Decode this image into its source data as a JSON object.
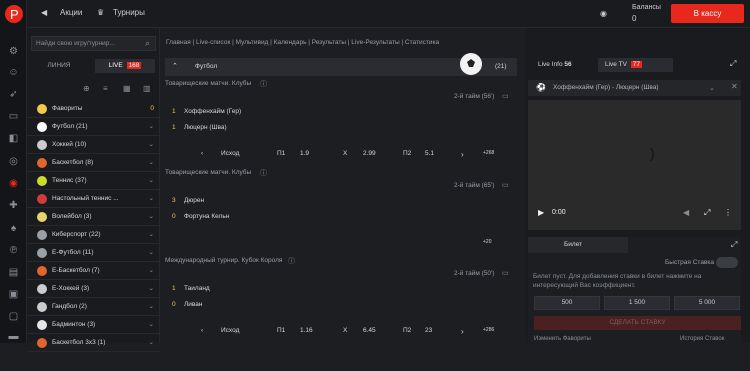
{
  "topbar": {
    "promo": "Акции",
    "tournaments": "Турниры",
    "balance_label": "Балансы",
    "balance_value": "0",
    "cashier": "В кассу"
  },
  "sidebar": {
    "search_placeholder": "Найди свою игру/турнир...",
    "tab_line": "ЛИНИЯ",
    "tab_live": "LIVE",
    "live_count": "168",
    "items": [
      {
        "label": "Фавориты",
        "count": "0",
        "color": "#f2c94c"
      },
      {
        "label": "Футбол (21)",
        "color": "#ffffff"
      },
      {
        "label": "Хоккей (10)",
        "color": "#cccccc"
      },
      {
        "label": "Баскетбол (8)",
        "color": "#e0662c"
      },
      {
        "label": "Теннис (37)",
        "color": "#c8dd2c"
      },
      {
        "label": "Настольный теннис ...",
        "color": "#d23b3b"
      },
      {
        "label": "Волейбол (3)",
        "color": "#e6d56a"
      },
      {
        "label": "Киберспорт (22)",
        "color": "#9aa0a8"
      },
      {
        "label": "E-Футбол (11)",
        "color": "#9aa0a8"
      },
      {
        "label": "E-Баскетбол (7)",
        "color": "#e0662c"
      },
      {
        "label": "E-Хоккей (3)",
        "color": "#cccccc"
      },
      {
        "label": "Гандбол (2)",
        "color": "#cccccc"
      },
      {
        "label": "Бадминтон (3)",
        "color": "#e6e6e6"
      },
      {
        "label": "Баскетбол 3x3 (1)",
        "color": "#e0662c"
      }
    ]
  },
  "main": {
    "breadcrumb": "Главная | Live-список | Мультивид | Календарь | Результаты | Live-Результаты | Статистика",
    "sport": "Футбол",
    "sport_count": "(21)",
    "events": [
      {
        "section": "Товарищеские матчи. Клубы",
        "status": "2-й тайм (56')",
        "team1_score": "1",
        "team1": "Хоффенхайм (Гер)",
        "team2_score": "1",
        "team2": "Люцерн (Шва)",
        "outcome": "Исход",
        "p1": "П1",
        "p1v": "1.9",
        "x": "Х",
        "xv": "2.99",
        "p2": "П2",
        "p2v": "5.1",
        "more": "+268"
      },
      {
        "section": "Товарищеские матчи. Клубы",
        "status": "2-й тайм (65')",
        "team1_score": "3",
        "team1": "Дюрен",
        "team2_score": "0",
        "team2": "Фортуна Кельн",
        "more": "+20"
      },
      {
        "section": "Международный турнир. Кубок Короля",
        "status": "2-й тайм (50')",
        "team1_score": "1",
        "team1": "Таиланд",
        "team2_score": "0",
        "team2": "Ливан",
        "outcome": "Исход",
        "p1": "П1",
        "p1v": "1.16",
        "x": "Х",
        "xv": "6.45",
        "p2": "П2",
        "p2v": "23",
        "more": "+286"
      }
    ]
  },
  "right": {
    "live_info": "Live Info",
    "live_info_count": "56",
    "live_tv": "Live TV",
    "live_tv_count": "77",
    "channel": "Хоффенхайм (Гер) - Люцерн (Шва)",
    "time": "0:00",
    "bet_title": "Билет",
    "fast_bet": "Быстрая Ставка",
    "bet_empty": "Билет пуст. Для добавления ставки в билет нажмите на интересующий Вас коэффициент.",
    "stakes": [
      "500",
      "1 500",
      "5 000"
    ],
    "place_bet": "СДЕЛАТЬ СТАВКУ",
    "change_odds": "Изменить Фавориты",
    "history": "История Ставок"
  }
}
